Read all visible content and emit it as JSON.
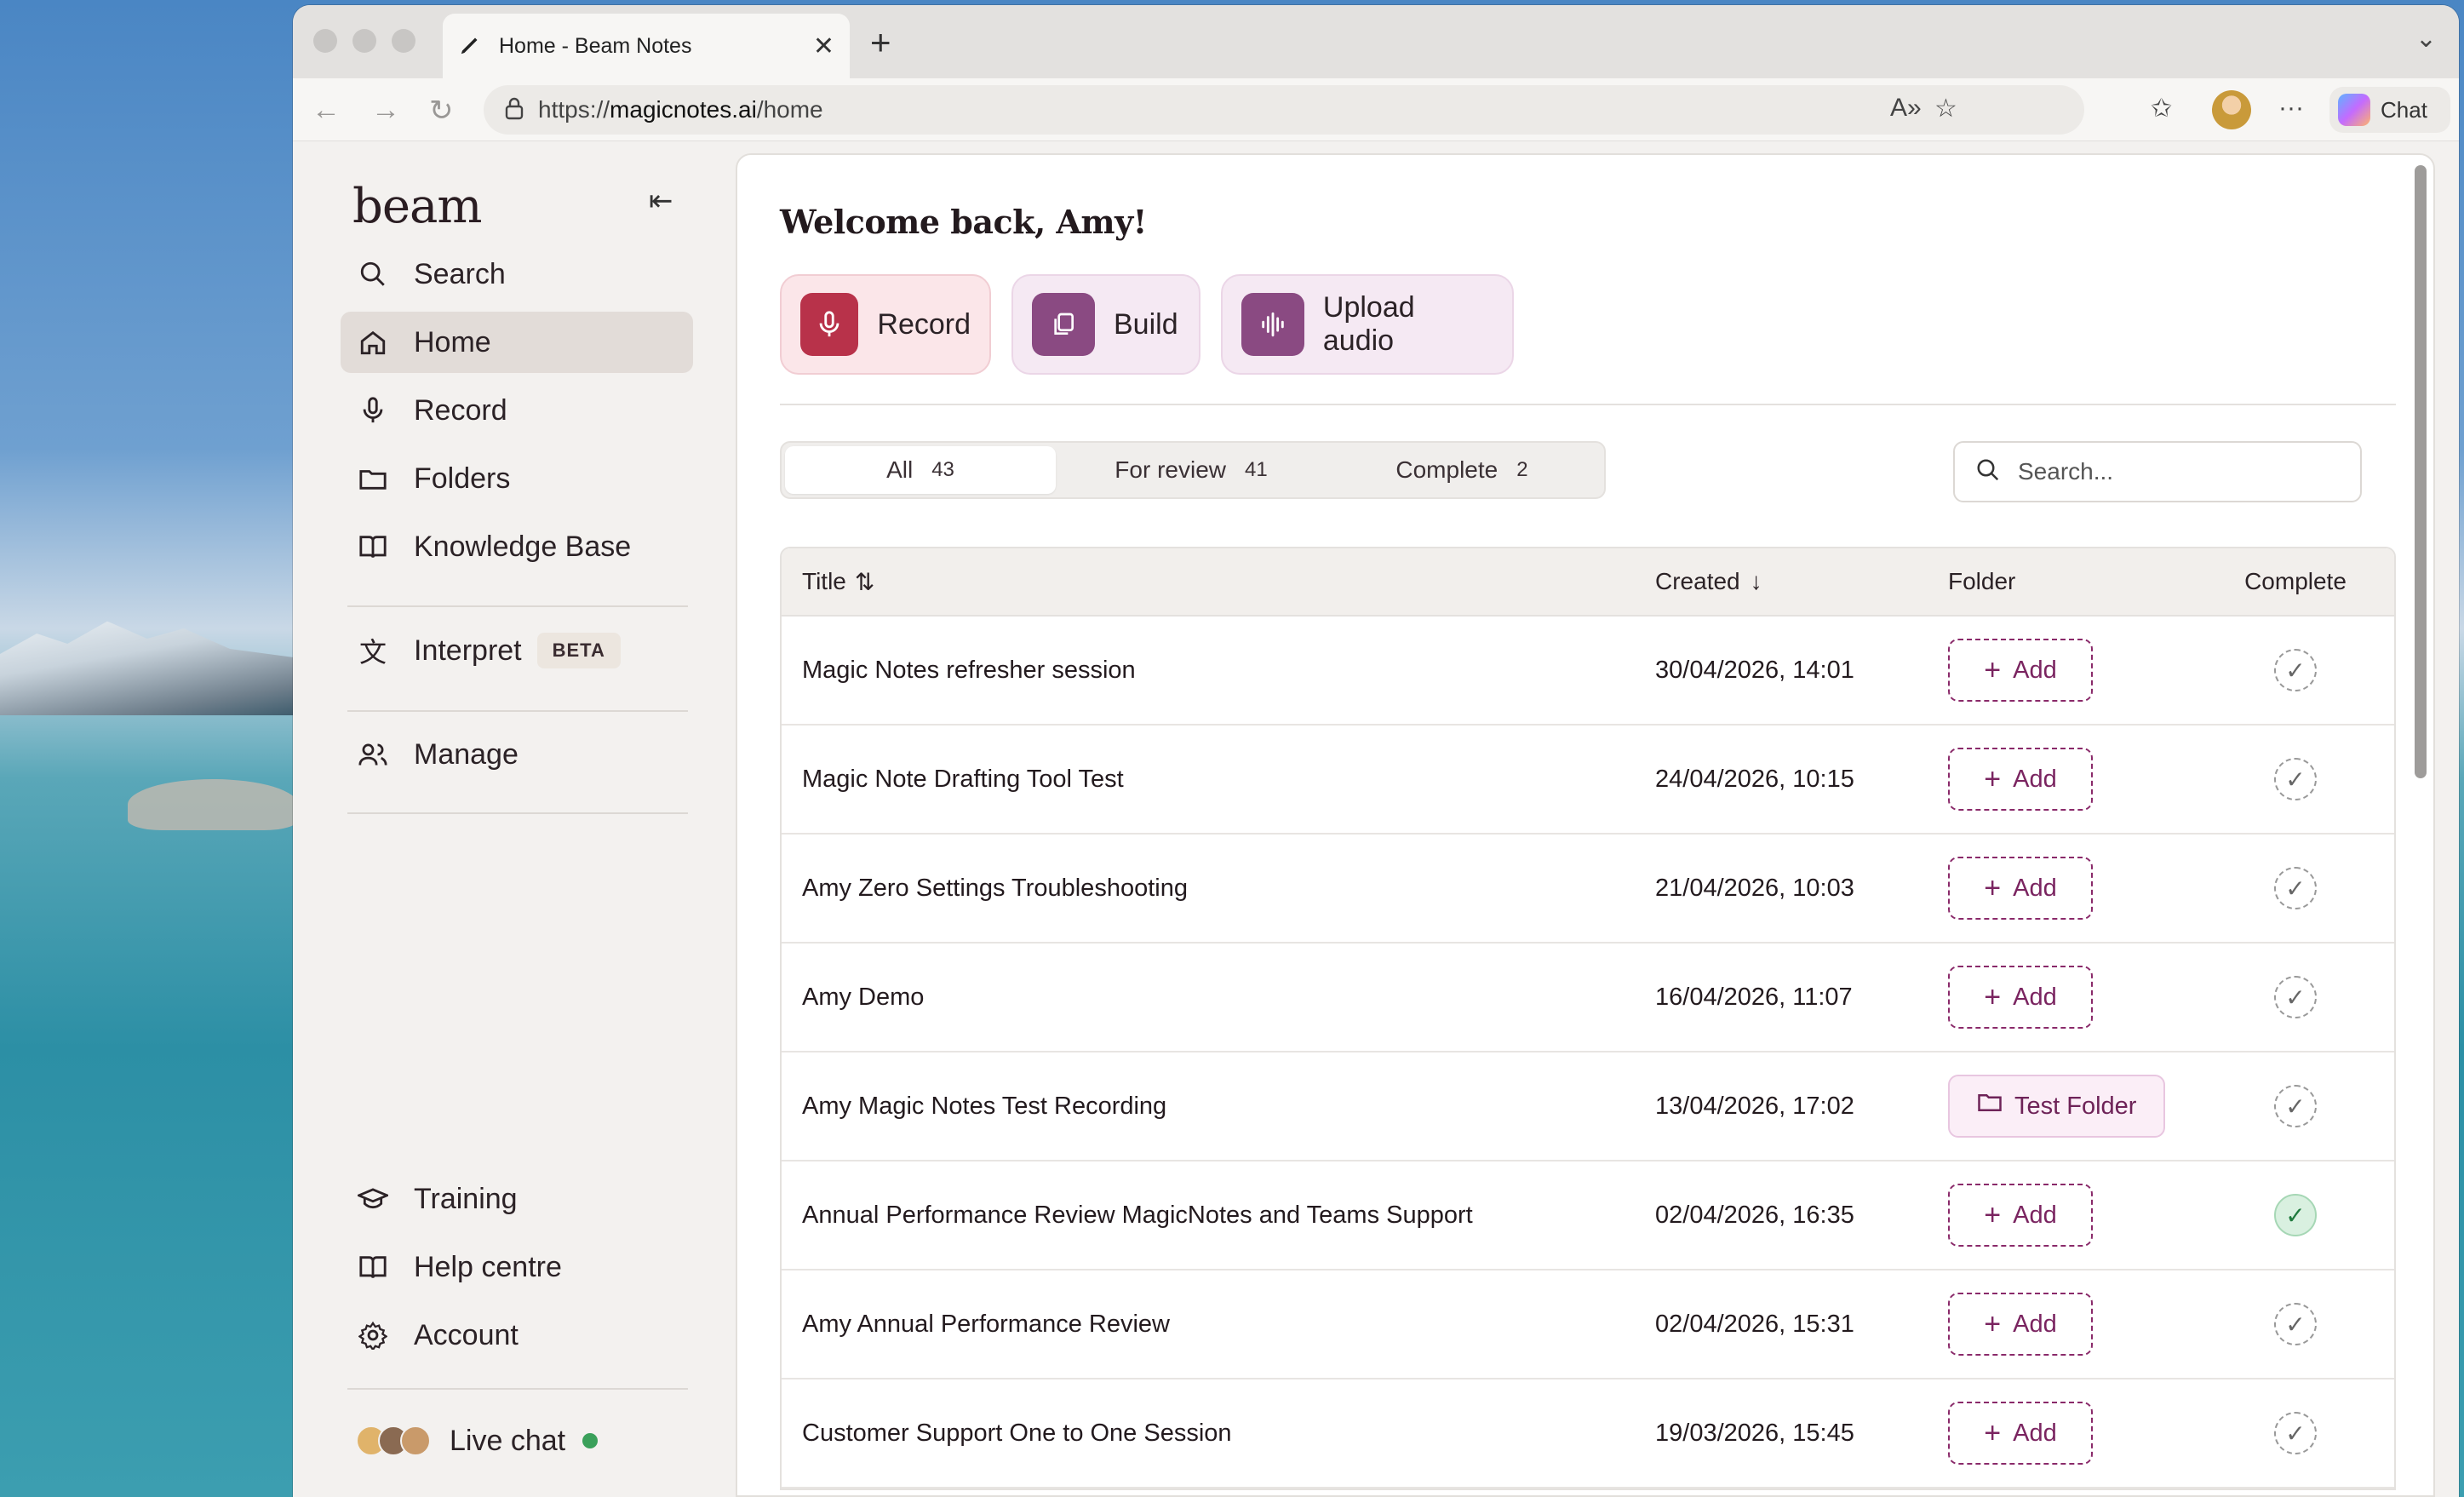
{
  "browser": {
    "tab_title": "Home - Beam Notes",
    "url_prefix": "https://",
    "url_host": "magicnotes.ai",
    "url_path": "/home",
    "chat_label": "Chat",
    "new_tab_glyph": "+",
    "close_glyph": "✕"
  },
  "sidebar": {
    "logo": "beam",
    "items": [
      {
        "label": "Search",
        "icon": "search-icon"
      },
      {
        "label": "Home",
        "icon": "home-icon"
      },
      {
        "label": "Record",
        "icon": "microphone-icon"
      },
      {
        "label": "Folders",
        "icon": "folder-icon"
      },
      {
        "label": "Knowledge Base",
        "icon": "book-icon"
      },
      {
        "label": "Interpret",
        "icon": "translate-icon",
        "badge": "BETA"
      },
      {
        "label": "Manage",
        "icon": "users-icon"
      },
      {
        "label": "Training",
        "icon": "graduation-cap-icon"
      },
      {
        "label": "Help centre",
        "icon": "book-icon"
      },
      {
        "label": "Account",
        "icon": "gear-icon"
      }
    ],
    "live_chat": "Live chat",
    "live_status_color": "#3aa05a"
  },
  "main": {
    "welcome": "Welcome back, Amy!",
    "actions": [
      {
        "label": "Record",
        "icon": "microphone-icon",
        "color": "#b8324a"
      },
      {
        "label": "Build",
        "icon": "copy-icon",
        "color": "#8a4a82"
      },
      {
        "label": "Upload audio",
        "icon": "waveform-icon",
        "color": "#8a4a82"
      }
    ],
    "filters": [
      {
        "label": "All",
        "count": "43"
      },
      {
        "label": "For review",
        "count": "41"
      },
      {
        "label": "Complete",
        "count": "2"
      }
    ],
    "search_placeholder": "Search...",
    "columns": {
      "title": "Title",
      "created": "Created",
      "folder": "Folder",
      "complete": "Complete"
    },
    "rows": [
      {
        "title": "Magic Notes refresher session",
        "created": "30/04/2026, 14:01",
        "folder": "Add",
        "complete": false
      },
      {
        "title": "Magic Note Drafting Tool Test",
        "created": "24/04/2026, 10:15",
        "folder": "Add",
        "complete": false
      },
      {
        "title": "Amy Zero Settings Troubleshooting",
        "created": "21/04/2026, 10:03",
        "folder": "Add",
        "complete": false
      },
      {
        "title": "Amy Demo",
        "created": "16/04/2026, 11:07",
        "folder": "Add",
        "complete": false
      },
      {
        "title": "Amy Magic Notes Test Recording",
        "created": "13/04/2026, 17:02",
        "folder": "Test Folder",
        "complete": false
      },
      {
        "title": "Annual Performance Review MagicNotes and Teams Support",
        "created": "02/04/2026, 16:35",
        "folder": "Add",
        "complete": true
      },
      {
        "title": "Amy Annual Performance Review",
        "created": "02/04/2026, 15:31",
        "folder": "Add",
        "complete": false
      },
      {
        "title": "Customer Support One to One Session",
        "created": "19/03/2026, 15:45",
        "folder": "Add",
        "complete": false
      }
    ]
  }
}
